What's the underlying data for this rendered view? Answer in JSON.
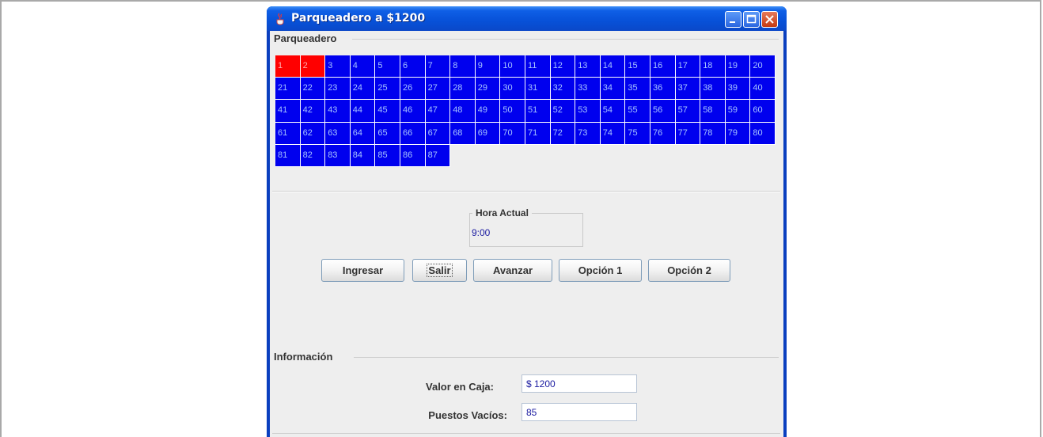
{
  "window": {
    "title": "Parqueadero a $1200",
    "controls": [
      "minimize",
      "maximize",
      "close"
    ]
  },
  "parking": {
    "section_title": "Parqueadero",
    "spots": [
      "1",
      "2",
      "3",
      "4",
      "5",
      "6",
      "7",
      "8",
      "9",
      "10",
      "11",
      "12",
      "13",
      "14",
      "15",
      "16",
      "17",
      "18",
      "19",
      "20",
      "21",
      "22",
      "23",
      "24",
      "25",
      "26",
      "27",
      "28",
      "29",
      "30",
      "31",
      "32",
      "33",
      "34",
      "35",
      "36",
      "37",
      "38",
      "39",
      "40",
      "41",
      "42",
      "43",
      "44",
      "45",
      "46",
      "47",
      "48",
      "49",
      "50",
      "51",
      "52",
      "53",
      "54",
      "55",
      "56",
      "57",
      "58",
      "59",
      "60",
      "61",
      "62",
      "63",
      "64",
      "65",
      "66",
      "67",
      "68",
      "69",
      "70",
      "71",
      "72",
      "73",
      "74",
      "75",
      "76",
      "77",
      "78",
      "79",
      "80",
      "81",
      "82",
      "83",
      "84",
      "85",
      "86",
      "87"
    ],
    "occupied": [
      "1",
      "2"
    ],
    "colors": {
      "free": "#0000ee",
      "occupied": "#ff0000"
    }
  },
  "time": {
    "label": "Hora Actual",
    "value": "9:00"
  },
  "buttons": {
    "ingresar": "Ingresar",
    "salir": "Salir",
    "avanzar": "Avanzar",
    "opcion1": "Opción 1",
    "opcion2": "Opción 2"
  },
  "info": {
    "section_title": "Información",
    "caja_label": "Valor en Caja:",
    "caja_value": "$ 1200",
    "vacios_label": "Puestos Vacíos:",
    "vacios_value": "85"
  }
}
